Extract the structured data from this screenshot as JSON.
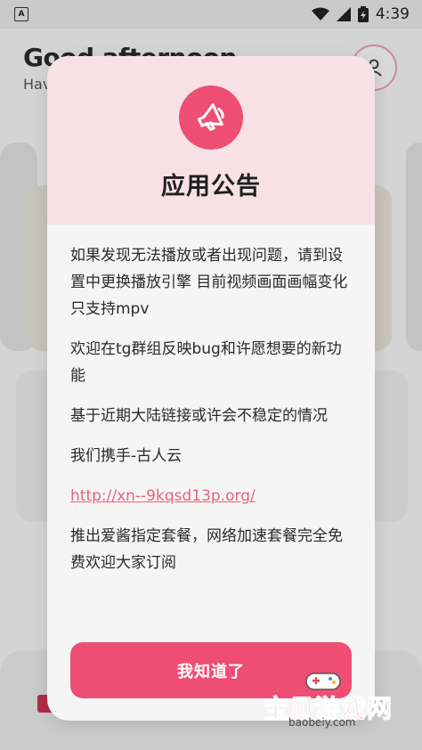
{
  "status_bar": {
    "time": "4:39",
    "app_icon_letter": "A",
    "icons": [
      "wifi-icon",
      "signal-icon",
      "battery-icon"
    ]
  },
  "background": {
    "greeting": "Good afternoon",
    "subtitle": "Hav"
  },
  "dialog": {
    "icon": "megaphone-icon",
    "title": "应用公告",
    "paragraphs": [
      "如果发现无法播放或者出现问题，请到设置中更换播放引擎 目前视频画面画幅变化只支持mpv",
      "欢迎在tg群组反映bug和许愿想要的新功能",
      "基于近期大陆链接或许会不稳定的情况",
      "我们携手-古人云",
      "http://xn--9kqsd13p.org/",
      "推出爱酱指定套餐，网络加速套餐完全免费欢迎大家订阅"
    ],
    "ok_label": "我知道了"
  },
  "watermark": {
    "text": "宝贝游戏网",
    "url": "baobeiy.com"
  },
  "colors": {
    "accent": "#ef4e74",
    "header_bg": "#f7e1e6",
    "link": "#e8617f"
  }
}
